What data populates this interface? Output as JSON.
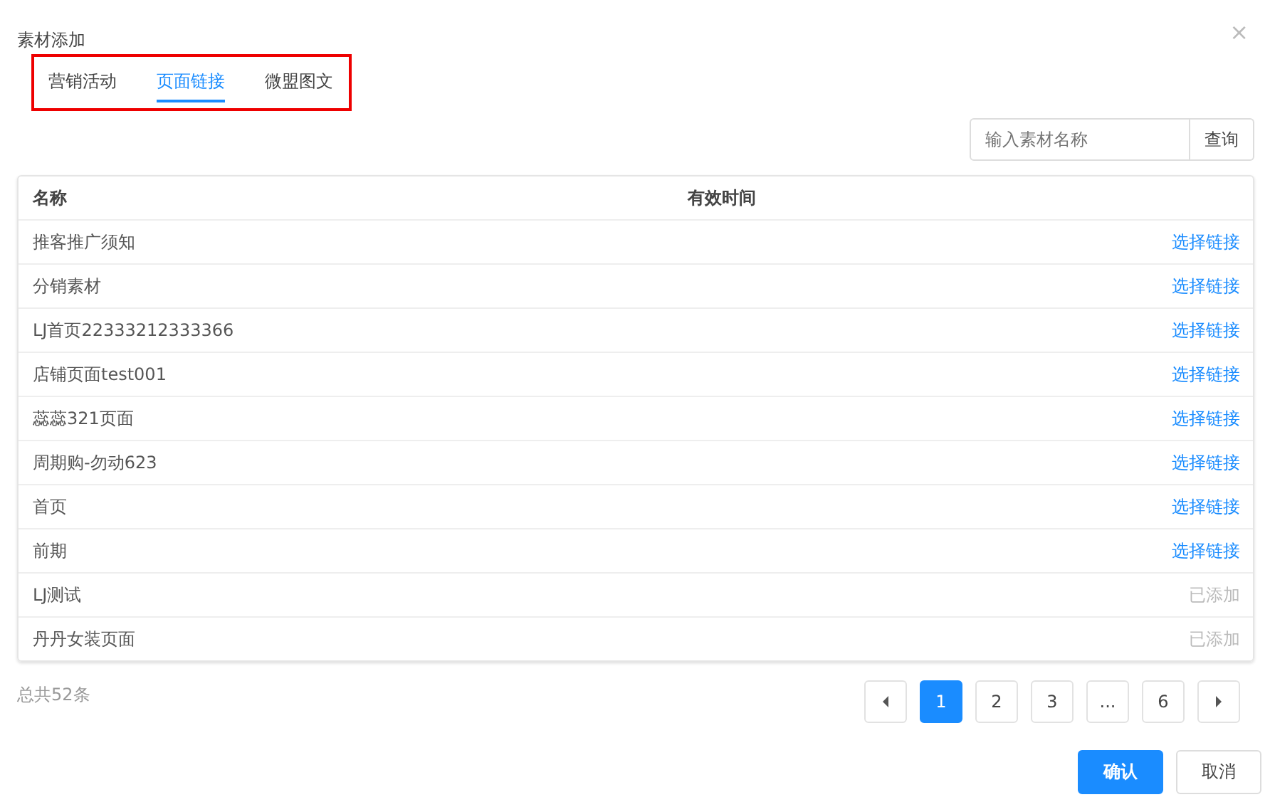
{
  "dialog": {
    "title": "素材添加",
    "close": "×"
  },
  "tabs": [
    {
      "label": "营销活动",
      "selected": false
    },
    {
      "label": "页面链接",
      "selected": true
    },
    {
      "label": "微盟图文",
      "selected": false
    }
  ],
  "search": {
    "placeholder": "输入素材名称",
    "button": "查询"
  },
  "table": {
    "columns": [
      "名称",
      "有效时间"
    ],
    "rows": [
      {
        "name": "推客推广须知",
        "action": "选择链接",
        "added": false
      },
      {
        "name": "分销素材",
        "action": "选择链接",
        "added": false
      },
      {
        "name": "LJ首页22333212333366",
        "action": "选择链接",
        "added": false
      },
      {
        "name": "店铺页面test001",
        "action": "选择链接",
        "added": false
      },
      {
        "name": "蕊蕊321页面",
        "action": "选择链接",
        "added": false
      },
      {
        "name": "周期购-勿动623",
        "action": "选择链接",
        "added": false
      },
      {
        "name": "首页",
        "action": "选择链接",
        "added": false
      },
      {
        "name": "前期",
        "action": "选择链接",
        "added": false
      },
      {
        "name": "LJ测试",
        "action": "已添加",
        "added": true
      },
      {
        "name": "丹丹女装页面",
        "action": "已添加",
        "added": true
      }
    ]
  },
  "total": "总共52条",
  "pagination": [
    {
      "label": "1",
      "selected": true
    },
    {
      "label": "2",
      "selected": false
    },
    {
      "label": "3",
      "selected": false
    },
    {
      "label": "...",
      "selected": false
    },
    {
      "label": "6",
      "selected": false
    }
  ],
  "buttons": {
    "confirm": "确认",
    "cancel": "取消"
  }
}
